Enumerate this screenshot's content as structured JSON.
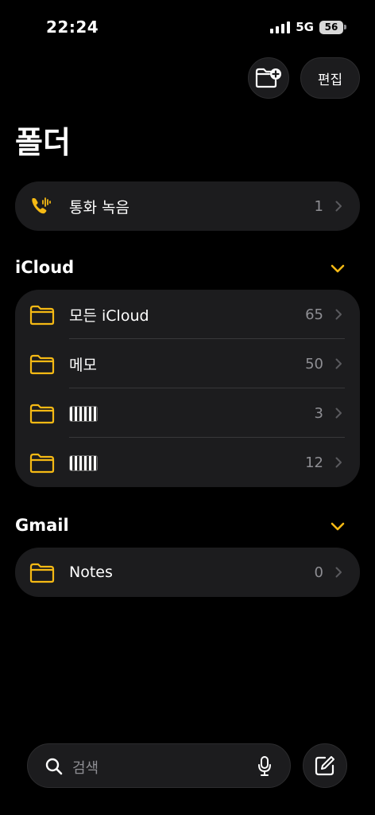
{
  "status_bar": {
    "time": "22:24",
    "network": "5G",
    "battery": "56"
  },
  "header": {
    "new_folder_icon": "folder-plus-icon",
    "edit_label": "편집",
    "title": "폴더"
  },
  "call_recordings": {
    "label": "통화 녹음",
    "count": "1",
    "icon": "phone-waveform-icon"
  },
  "sections": [
    {
      "name": "iCloud",
      "folders": [
        {
          "label": "모든 iCloud",
          "count": "65",
          "redacted": false
        },
        {
          "label": "메모",
          "count": "50",
          "redacted": false
        },
        {
          "label": "",
          "count": "3",
          "redacted": true
        },
        {
          "label": "",
          "count": "12",
          "redacted": true
        }
      ]
    },
    {
      "name": "Gmail",
      "folders": [
        {
          "label": "Notes",
          "count": "0",
          "redacted": false
        }
      ]
    }
  ],
  "bottom": {
    "search_placeholder": "검색",
    "compose_icon": "compose-icon"
  },
  "colors": {
    "accent": "#f5b914",
    "background": "#000000",
    "card": "#1c1c1e",
    "secondary_text": "#8e8e93"
  }
}
